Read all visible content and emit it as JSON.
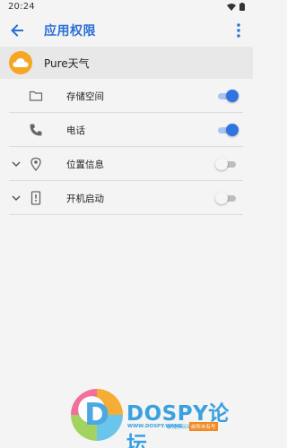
{
  "status_bar": {
    "time": "20:24"
  },
  "app_bar": {
    "title": "应用权限"
  },
  "app": {
    "name": "Pure天气"
  },
  "permissions": [
    {
      "label": "存储空间",
      "icon": "folder-icon",
      "enabled": true,
      "expandable": false
    },
    {
      "label": "电话",
      "icon": "phone-icon",
      "enabled": true,
      "expandable": false
    },
    {
      "label": "位置信息",
      "icon": "location-icon",
      "enabled": false,
      "expandable": true
    },
    {
      "label": "开机启动",
      "icon": "power-boot-icon",
      "enabled": false,
      "expandable": true
    }
  ],
  "watermark": {
    "letter": "D",
    "title": "DOSPY论坛",
    "url": "WWW.DOSPY.WANG",
    "sub": "最懂模玩坛",
    "tag": "前所未有号"
  },
  "colors": {
    "accent": "#2f74e0",
    "app_icon": "#f5a623"
  }
}
